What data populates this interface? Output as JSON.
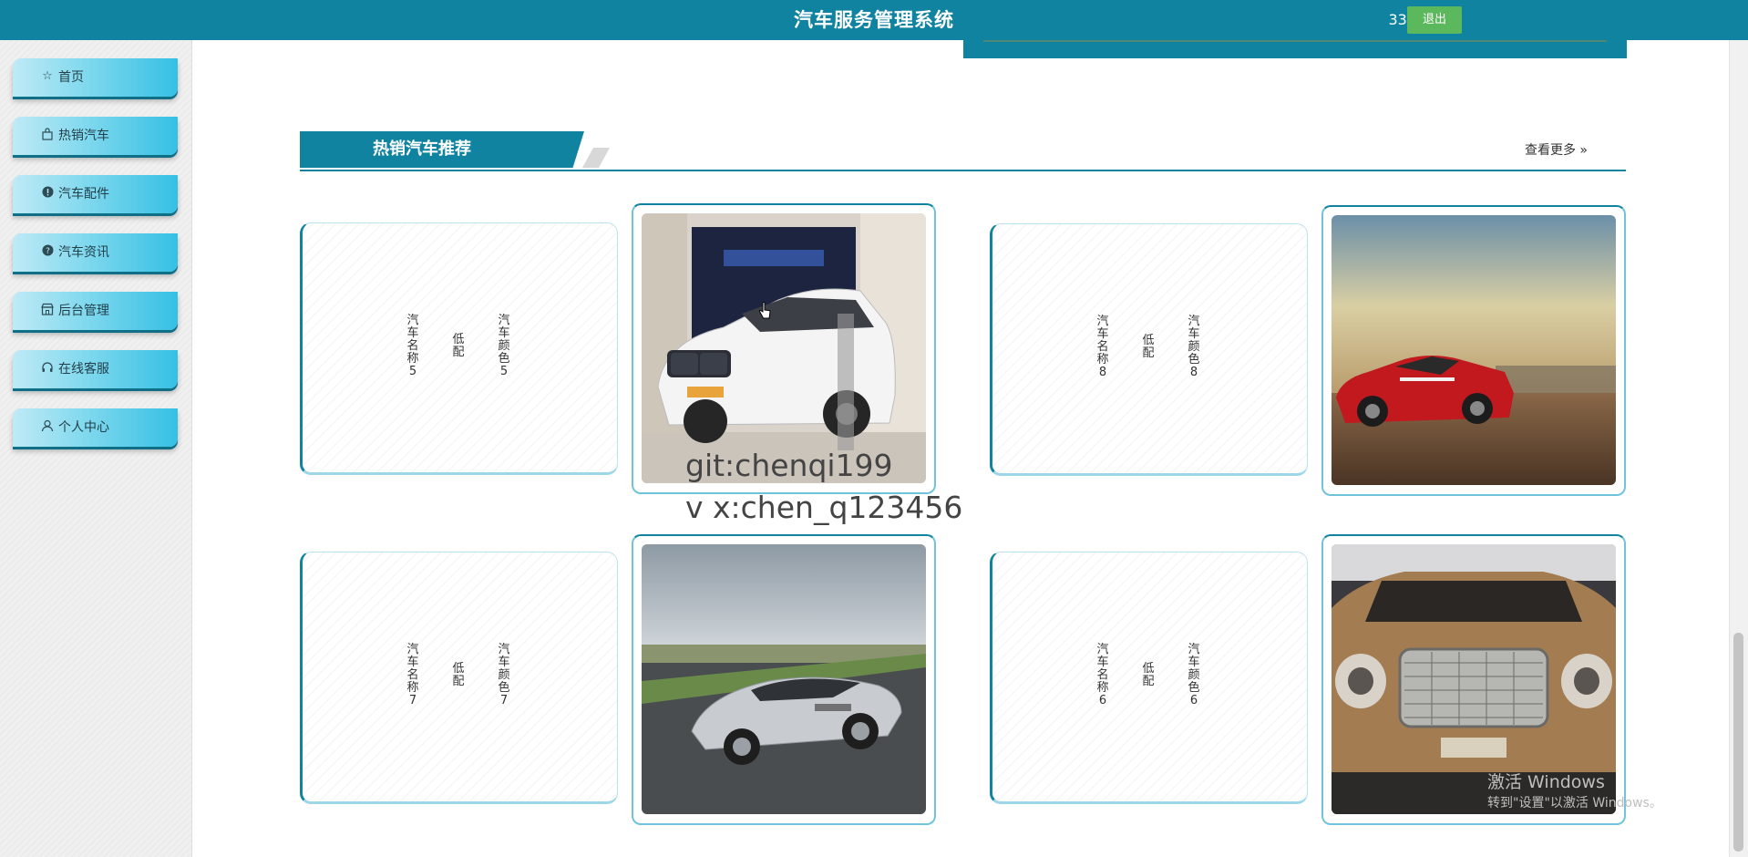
{
  "header": {
    "title": "汽车服务管理系统",
    "user": "333",
    "logout_label": "退出"
  },
  "sidebar": {
    "items": [
      {
        "label": "首页",
        "icon": "star-icon"
      },
      {
        "label": "热销汽车",
        "icon": "bag-icon"
      },
      {
        "label": "汽车配件",
        "icon": "alert-icon"
      },
      {
        "label": "汽车资讯",
        "icon": "question-icon"
      },
      {
        "label": "后台管理",
        "icon": "store-icon"
      },
      {
        "label": "在线客服",
        "icon": "headset-icon"
      },
      {
        "label": "个人中心",
        "icon": "user-icon"
      }
    ]
  },
  "section": {
    "title": "热销汽车推荐",
    "more_label": "查看更多"
  },
  "cars": [
    {
      "name": "汽车名称5",
      "config": "低配",
      "color": "汽车颜色5"
    },
    {
      "name": "汽车名称8",
      "config": "低配",
      "color": "汽车颜色8"
    },
    {
      "name": "汽车名称7",
      "config": "低配",
      "color": "汽车颜色7"
    },
    {
      "name": "汽车名称6",
      "config": "低配",
      "color": "汽车颜色6"
    }
  ],
  "overlay": {
    "watermark_line1": "git:chenqi199",
    "watermark_line2": "v x:chen_q123456",
    "windows_line1": "激活 Windows",
    "windows_line2": "转到\"设置\"以激活 Windows。"
  },
  "colors": {
    "primary": "#0f839f",
    "logout": "#5cb85c",
    "nav_gradient_end": "#35c0e4"
  }
}
